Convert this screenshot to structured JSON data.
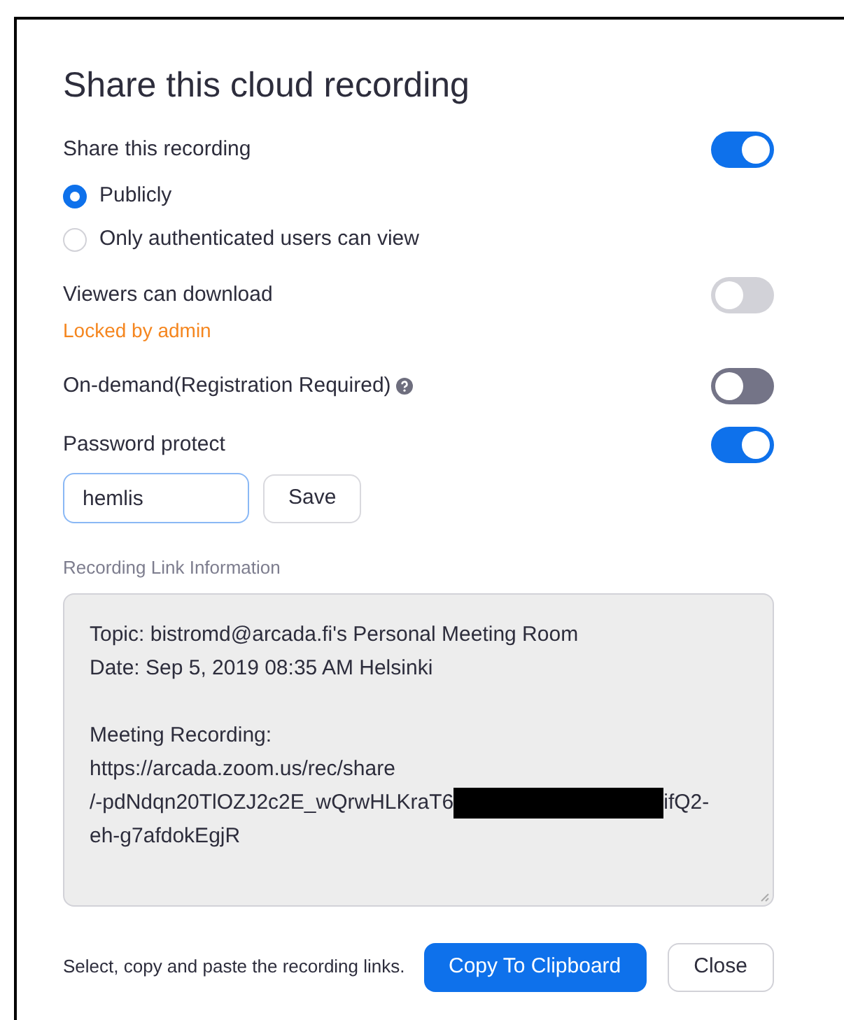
{
  "dialog": {
    "title": "Share this cloud recording"
  },
  "settings": [
    {
      "kind": "toggle",
      "label": "Share this recording",
      "on": true,
      "disabled": false
    },
    {
      "kind": "radio",
      "label": "Publicly",
      "selected": true
    },
    {
      "kind": "radio",
      "label": "Only authenticated users can view",
      "selected": false
    },
    {
      "kind": "toggle",
      "label": "Viewers can download",
      "note": "Locked by admin",
      "on": false,
      "disabled": true
    },
    {
      "kind": "toggle",
      "label": "On-demand(Registration Required)",
      "help": true,
      "on": false,
      "disabled": false
    },
    {
      "kind": "toggle",
      "label": "Password protect",
      "on": true,
      "disabled": false
    }
  ],
  "password": {
    "value": "hemlis",
    "save_button": "Save"
  },
  "link_info": {
    "label": "Recording Link Information",
    "paragraphs": [
      [
        [
          {
            "kind": "text",
            "text": "Topic: bistromd@arcada.fi's Personal Meeting Room"
          }
        ],
        [
          {
            "kind": "text",
            "text": "Date: Sep 5, 2019 08:35 AM Helsinki"
          }
        ]
      ],
      [
        [
          {
            "kind": "text",
            "text": "Meeting Recording:"
          }
        ],
        [
          {
            "kind": "text",
            "text": "https://arcada.zoom.us/rec/share"
          }
        ],
        [
          {
            "kind": "text",
            "text": "/-pdNdqn20TlOZJ2c2E_wQrwHLKraT6"
          },
          {
            "kind": "redacted"
          },
          {
            "kind": "text",
            "text": "ifQ2-"
          }
        ],
        [
          {
            "kind": "text",
            "text": "eh-g7afdokEgjR"
          }
        ]
      ]
    ]
  },
  "footer": {
    "hint": "Select, copy and paste the recording links.",
    "buttons": [
      {
        "label": "Copy To Clipboard",
        "kind": "primary"
      },
      {
        "label": "Close",
        "kind": "secondary"
      }
    ]
  }
}
